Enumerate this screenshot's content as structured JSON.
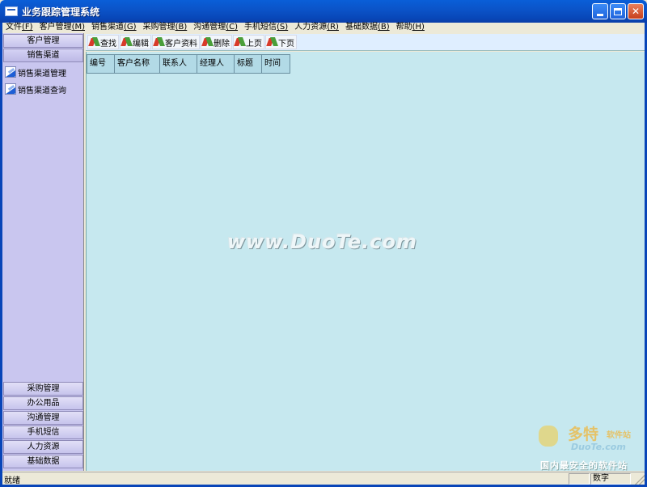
{
  "window": {
    "title": "业务跟踪管理系统",
    "minimize_label": "_",
    "maximize_label": "□",
    "close_label": "✕"
  },
  "menu": [
    {
      "label": "文件",
      "key": "(F)"
    },
    {
      "label": "客户管理",
      "key": "(M)"
    },
    {
      "label": "销售渠道",
      "key": "(G)"
    },
    {
      "label": "采购管理",
      "key": "(B)"
    },
    {
      "label": "沟通管理",
      "key": "(C)"
    },
    {
      "label": "手机短信",
      "key": "(S)"
    },
    {
      "label": "人力资源",
      "key": "(R)"
    },
    {
      "label": "基础数据",
      "key": "(B)"
    },
    {
      "label": "帮助",
      "key": "(H)"
    }
  ],
  "sidebar": {
    "top_groups": [
      "客户管理",
      "销售渠道"
    ],
    "sub_items": [
      "销售渠道管理",
      "销售渠道查询"
    ],
    "bottom_groups": [
      "采购管理",
      "办公用品",
      "沟通管理",
      "手机短信",
      "人力资源",
      "基础数据"
    ]
  },
  "toolbar": [
    "查找",
    "编辑",
    "客户资料",
    "删除",
    "上页",
    "下页"
  ],
  "table": {
    "columns": [
      "编号",
      "客户名称",
      "联系人",
      "经理人",
      "标题",
      "时间"
    ]
  },
  "watermark": "www.DuoTe.com",
  "logo": {
    "name": "多特",
    "name_suffix": "软件站",
    "url": "DuoTe.com",
    "slogan": "国内最安全的软件站"
  },
  "statusbar": {
    "text": "就绪",
    "pane_num": "数字"
  }
}
